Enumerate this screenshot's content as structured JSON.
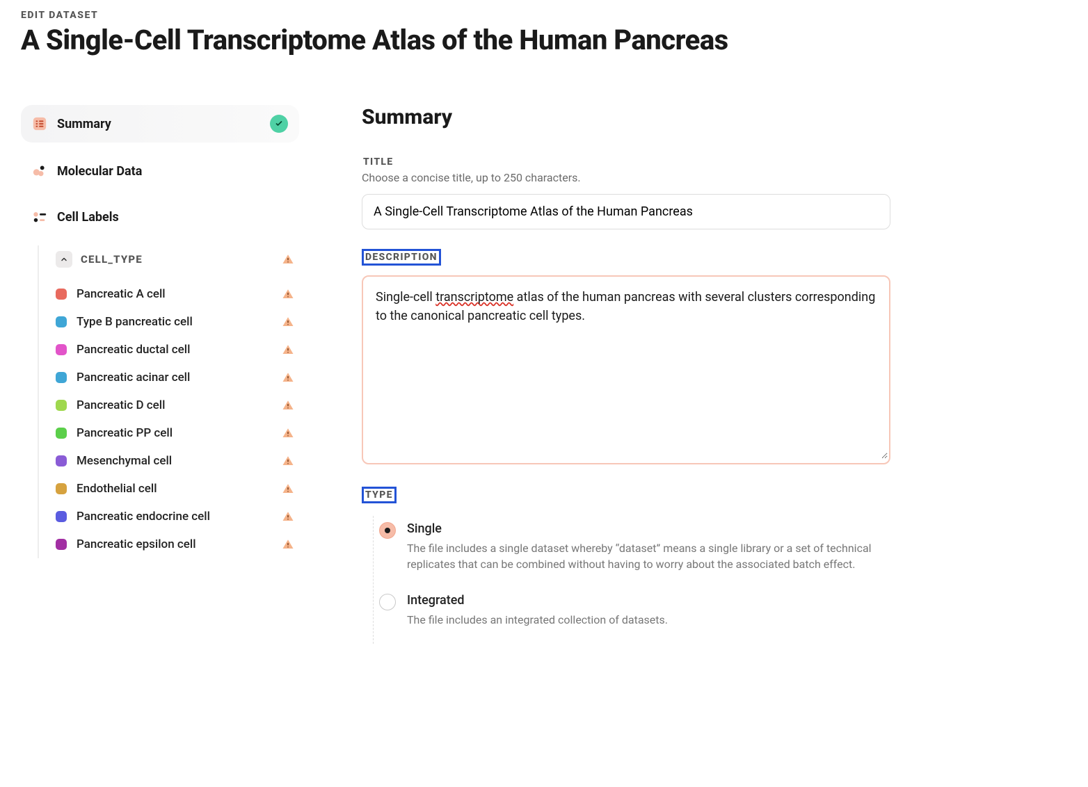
{
  "header": {
    "eyebrow": "Edit Dataset",
    "title": "A Single-Cell Transcriptome Atlas of the Human Pancreas"
  },
  "sidebar": {
    "items": [
      {
        "label": "Summary",
        "status": "ok",
        "icon": "list"
      },
      {
        "label": "Molecular Data",
        "icon": "molecule"
      },
      {
        "label": "Cell Labels",
        "icon": "labels"
      }
    ],
    "cell_type_group": {
      "header": "cell_type",
      "cells": [
        {
          "label": "Pancreatic A cell",
          "color": "#e86a5e"
        },
        {
          "label": "Type B pancreatic cell",
          "color": "#3fa6d6"
        },
        {
          "label": "Pancreatic ductal cell",
          "color": "#e254c9"
        },
        {
          "label": "Pancreatic acinar cell",
          "color": "#3fa6d6"
        },
        {
          "label": "Pancreatic D cell",
          "color": "#9fd84e"
        },
        {
          "label": "Pancreatic PP cell",
          "color": "#5bcf4a"
        },
        {
          "label": "Mesenchymal cell",
          "color": "#8a5cd6"
        },
        {
          "label": "Endothelial cell",
          "color": "#d6a23f"
        },
        {
          "label": "Pancreatic endocrine cell",
          "color": "#5a5ce0"
        },
        {
          "label": "Pancreatic epsilon cell",
          "color": "#a22fa3"
        }
      ]
    }
  },
  "main": {
    "heading": "Summary",
    "title_field": {
      "label": "Title",
      "hint": "Choose a concise title, up to 250 characters.",
      "value": "A Single-Cell Transcriptome Atlas of the Human Pancreas"
    },
    "description_field": {
      "label": "Description",
      "value": "Single-cell transcriptome atlas of the human pancreas with several clusters corresponding to the canonical pancreatic cell types.",
      "prefix": "Single-cell ",
      "squiggle_word": "transcriptome",
      "suffix": " atlas of the human pancreas with several clusters corresponding to the canonical pancreatic cell types."
    },
    "type_field": {
      "label": "Type",
      "options": [
        {
          "title": "Single",
          "desc": "The file includes a single dataset whereby “dataset” means a single library or a set of technical replicates that can be combined without having to worry about the associated batch effect.",
          "selected": true
        },
        {
          "title": "Integrated",
          "desc": "The file includes an integrated collection of datasets.",
          "selected": false
        }
      ]
    }
  }
}
